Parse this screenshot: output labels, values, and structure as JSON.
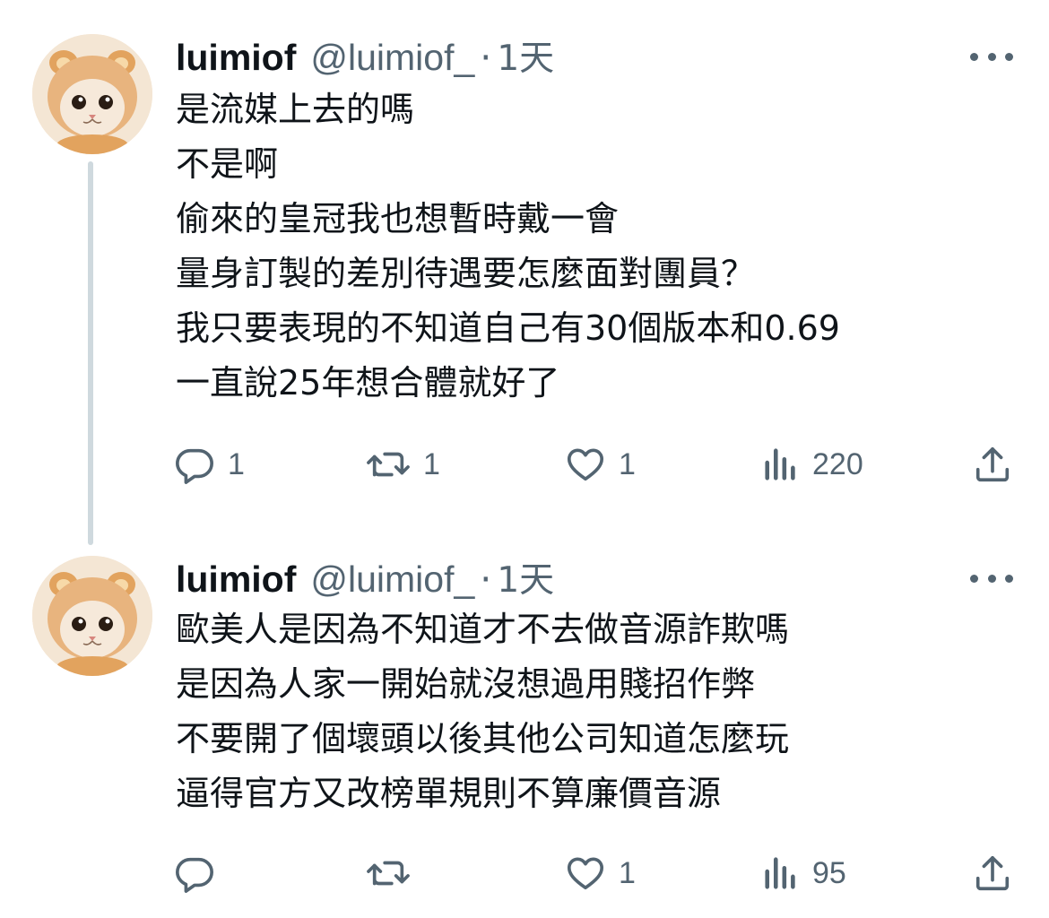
{
  "tweets": [
    {
      "name": "luimiof",
      "handle": "@luimiof_",
      "separator": "·",
      "time": "1天",
      "lines": [
        "是流媒上去的嗎",
        "不是啊",
        "偷來的皇冠我也想暫時戴一會",
        "量身訂製的差別待遇要怎麼面對團員？",
        "我只要表現的不知道自己有30個版本和0.69",
        "一直說25年想合體就好了"
      ],
      "replies": "1",
      "retweets": "1",
      "likes": "1",
      "views": "220"
    },
    {
      "name": "luimiof",
      "handle": "@luimiof_",
      "separator": "·",
      "time": "1天",
      "lines": [
        "歐美人是因為不知道才不去做音源詐欺嗎",
        "是因為人家一開始就沒想過用賤招作弊",
        "不要開了個壞頭以後其他公司知道怎麼玩",
        "逼得官方又改榜單規則不算廉價音源"
      ],
      "likes": "1",
      "views": "95"
    }
  ],
  "icons": {
    "reply": "reply-icon",
    "retweet": "retweet-icon",
    "like": "heart-icon",
    "views": "views-icon",
    "share": "share-icon",
    "more": "more-icon"
  },
  "colors": {
    "text": "#0f1419",
    "secondary": "#536471",
    "thread_line": "#cfd9de",
    "avatar_fur": "#e8b47e"
  }
}
